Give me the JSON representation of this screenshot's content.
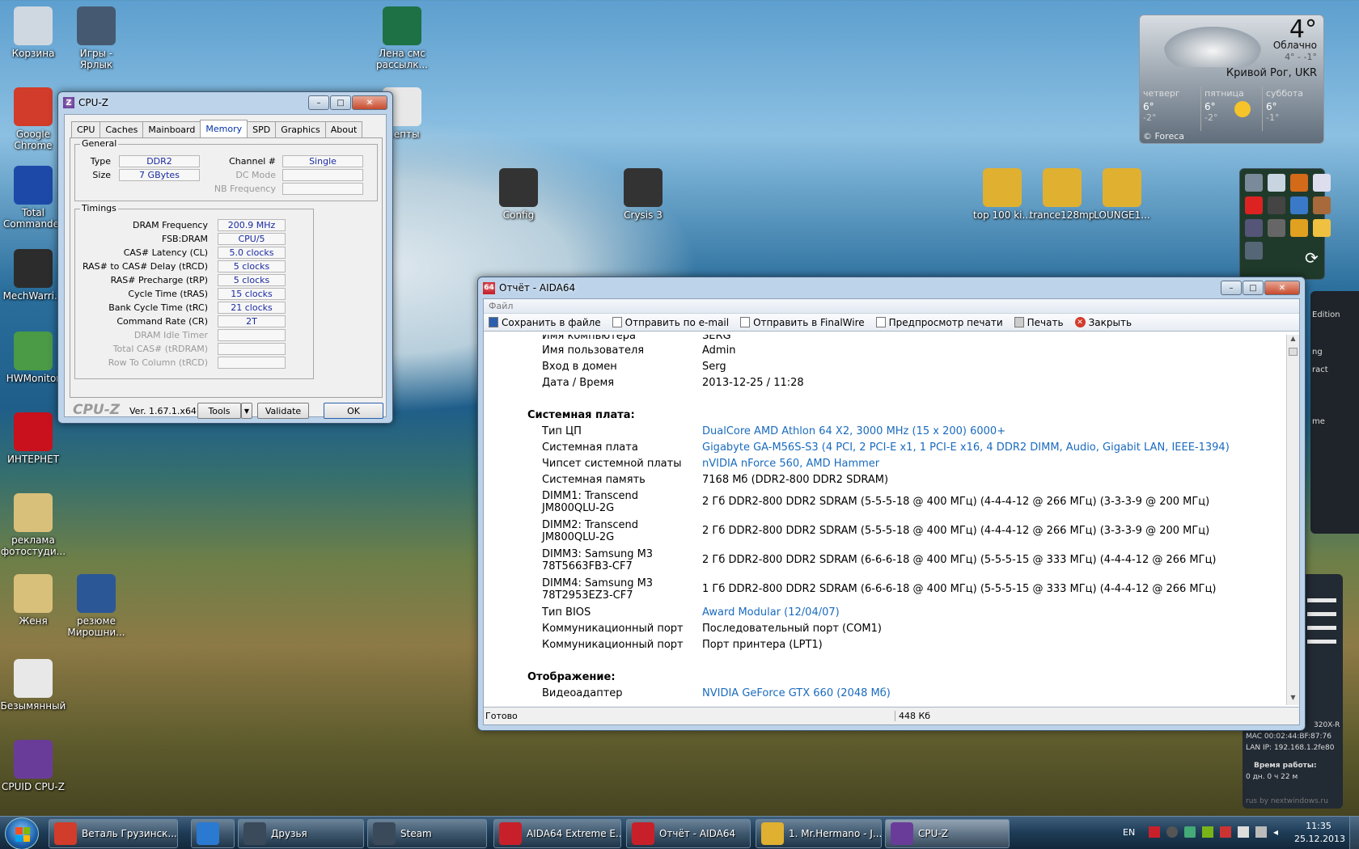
{
  "desktop_icons": [
    {
      "label": "Корзина",
      "icon": "recycle-bin-icon",
      "color": "#cfd8e0"
    },
    {
      "label": "Игры - Ярлык",
      "icon": "games-shortcut-icon",
      "color": "#455a70"
    },
    {
      "label": "Google Chrome",
      "icon": "chrome-icon",
      "color": "#d23c2a"
    },
    {
      "label": "Total Commander",
      "icon": "total-commander-icon",
      "color": "#1d49a8"
    },
    {
      "label": "MechWarri...",
      "icon": "mechwarrior-icon",
      "color": "#2c2c2c"
    },
    {
      "label": "HWMonitor",
      "icon": "hwmonitor-icon",
      "color": "#4a9a46"
    },
    {
      "label": "ИНТЕРНЕТ",
      "icon": "opera-icon",
      "color": "#c8111c"
    },
    {
      "label": "реклама фотостуди...",
      "icon": "folder-icon",
      "color": "#d9c07a"
    },
    {
      "label": "Женя",
      "icon": "folder-icon",
      "color": "#d9c07a"
    },
    {
      "label": "резюме Мирошни...",
      "icon": "word-doc-icon",
      "color": "#2b5797"
    },
    {
      "label": "Безымянный",
      "icon": "image-file-icon",
      "color": "#e8e8e8"
    },
    {
      "label": "CPUID CPU-Z",
      "icon": "cpuz-icon",
      "color": "#6a3c9a"
    },
    {
      "label": "Лена смс рассылк...",
      "icon": "excel-doc-icon",
      "color": "#1e7145"
    },
    {
      "label": "...епты",
      "icon": "document-icon",
      "color": "#e8e8e8"
    },
    {
      "label": "Config",
      "icon": "crysis-config-icon",
      "color": "#333"
    },
    {
      "label": "Crysis 3",
      "icon": "crysis-icon",
      "color": "#333"
    },
    {
      "label": "top 100 ki...",
      "icon": "playlist-icon",
      "color": "#e0b030"
    },
    {
      "label": "trance128mp",
      "icon": "playlist-icon",
      "color": "#e0b030"
    },
    {
      "label": "LOUNGE1...",
      "icon": "playlist-icon",
      "color": "#e0b030"
    }
  ],
  "weather": {
    "temp": "4°",
    "condition": "Облачно",
    "range": "4° - -1°",
    "city": "Кривой Рог, UKR",
    "days": [
      {
        "name": "четверг",
        "hi": "6°",
        "lo": "-2°"
      },
      {
        "name": "пятница",
        "hi": "6°",
        "lo": "-2°"
      },
      {
        "name": "суббота",
        "hi": "6°",
        "lo": "-1°"
      }
    ],
    "source": "© Foreca"
  },
  "cpuz": {
    "title": "CPU-Z",
    "tabs": [
      "CPU",
      "Caches",
      "Mainboard",
      "Memory",
      "SPD",
      "Graphics",
      "About"
    ],
    "active_tab": "Memory",
    "general": {
      "legend": "General",
      "type_label": "Type",
      "type": "DDR2",
      "size_label": "Size",
      "size": "7 GBytes",
      "channel_label": "Channel #",
      "channel": "Single",
      "dc_label": "DC Mode",
      "nb_label": "NB Frequency"
    },
    "timings": {
      "legend": "Timings",
      "rows": [
        {
          "label": "DRAM Frequency",
          "value": "200.9 MHz",
          "dim": false
        },
        {
          "label": "FSB:DRAM",
          "value": "CPU/5",
          "dim": false
        },
        {
          "label": "CAS# Latency (CL)",
          "value": "5.0 clocks",
          "dim": false
        },
        {
          "label": "RAS# to CAS# Delay (tRCD)",
          "value": "5 clocks",
          "dim": false
        },
        {
          "label": "RAS# Precharge (tRP)",
          "value": "5 clocks",
          "dim": false
        },
        {
          "label": "Cycle Time (tRAS)",
          "value": "15 clocks",
          "dim": false
        },
        {
          "label": "Bank Cycle Time (tRC)",
          "value": "21 clocks",
          "dim": false
        },
        {
          "label": "Command Rate (CR)",
          "value": "2T",
          "dim": false
        },
        {
          "label": "DRAM Idle Timer",
          "value": "",
          "dim": true
        },
        {
          "label": "Total CAS# (tRDRAM)",
          "value": "",
          "dim": true
        },
        {
          "label": "Row To Column (tRCD)",
          "value": "",
          "dim": true
        }
      ]
    },
    "footer": {
      "brand": "CPU-Z",
      "version": "Ver. 1.67.1.x64",
      "tools": "Tools",
      "validate": "Validate",
      "ok": "OK"
    }
  },
  "aida": {
    "title": "Отчёт - AIDA64",
    "menu": "Файл",
    "toolbar": [
      "Сохранить в файле",
      "Отправить по e-mail",
      "Отправить в FinalWire",
      "Предпросмотр печати",
      "Печать",
      "Закрыть"
    ],
    "partial_top": {
      "label": "Имя компьютера",
      "value": "SERG"
    },
    "rows": [
      {
        "label": "Имя пользователя",
        "value": "Admin",
        "link": false
      },
      {
        "label": "Вход в домен",
        "value": "Serg",
        "link": false
      },
      {
        "label": "Дата / Время",
        "value": "2013-12-25 / 11:28",
        "link": false
      }
    ],
    "sec_board": "Системная плата:",
    "board_rows": [
      {
        "label": "Тип ЦП",
        "value": "DualCore AMD Athlon 64 X2, 3000 MHz (15 x 200) 6000+",
        "link": true
      },
      {
        "label": "Системная плата",
        "value": "Gigabyte GA-M56S-S3 (4 PCI, 2 PCI-E x1, 1 PCI-E x16, 4 DDR2 DIMM, Audio, Gigabit LAN, IEEE-1394)",
        "link": true
      },
      {
        "label": "Чипсет системной платы",
        "value": "nVIDIA nForce 560, AMD Hammer",
        "link": true
      },
      {
        "label": "Системная память",
        "value": "7168 Мб  (DDR2-800 DDR2 SDRAM)",
        "link": false
      },
      {
        "label": "DIMM1: Transcend JM800QLU-2G",
        "value": "2 Гб DDR2-800 DDR2 SDRAM  (5-5-5-18 @ 400 МГц)  (4-4-4-12 @ 266 МГц)  (3-3-3-9 @ 200 МГц)",
        "link": false
      },
      {
        "label": "DIMM2: Transcend JM800QLU-2G",
        "value": "2 Гб DDR2-800 DDR2 SDRAM  (5-5-5-18 @ 400 МГц)  (4-4-4-12 @ 266 МГц)  (3-3-3-9 @ 200 МГц)",
        "link": false
      },
      {
        "label": "DIMM3: Samsung M3 78T5663FB3-CF7",
        "value": "2 Гб DDR2-800 DDR2 SDRAM  (6-6-6-18 @ 400 МГц)  (5-5-5-15 @ 333 МГц)  (4-4-4-12 @ 266 МГц)",
        "link": false
      },
      {
        "label": "DIMM4: Samsung M3 78T2953EZ3-CF7",
        "value": "1 Гб DDR2-800 DDR2 SDRAM  (6-6-6-18 @ 400 МГц)  (5-5-5-15 @ 333 МГц)  (4-4-4-12 @ 266 МГц)",
        "link": false
      },
      {
        "label": "Тип BIOS",
        "value": "Award Modular (12/04/07)",
        "link": true
      },
      {
        "label": "Коммуникационный порт",
        "value": "Последовательный порт (COM1)",
        "link": false
      },
      {
        "label": "Коммуникационный порт",
        "value": "Порт принтера (LPT1)",
        "link": false
      }
    ],
    "sec_display": "Отображение:",
    "display_rows": [
      {
        "label": "Видеоадаптер",
        "value": "NVIDIA GeForce GTX 660  (2048 Мб)",
        "link": true
      }
    ],
    "status_left": "Готово",
    "status_right": "448 Кб"
  },
  "side_gadget": {
    "mac": "MAC   00:02:44:BF:87:76",
    "lan": "LAN IP:   192.168.1.2fe80",
    "uptime_label": "Время работы:",
    "uptime": "0 дн. 0 ч 22 м",
    "credit": "rus by nextwindows.ru",
    "frag1": "Edition",
    "frag2": "ng",
    "frag3": "ract",
    "frag4": "me",
    "frag5": "320X-R"
  },
  "taskbar": {
    "buttons": [
      {
        "label": "Веталь Грузинск...",
        "icon": "chrome-icon",
        "color": "#d23c2a"
      },
      {
        "label": "",
        "icon": "ie-icon",
        "color": "#2a7ad2"
      },
      {
        "label": "Друзья",
        "icon": "steam-icon",
        "color": "#3a4a5a"
      },
      {
        "label": "Steam",
        "icon": "steam-icon",
        "color": "#3a4a5a"
      },
      {
        "label": "AIDA64 Extreme E...",
        "icon": "aida64-icon",
        "color": "#c8202a"
      },
      {
        "label": "Отчёт - AIDA64",
        "icon": "aida64-icon",
        "color": "#c8202a"
      },
      {
        "label": "1. Mr.Hermano - J...",
        "icon": "winamp-icon",
        "color": "#e0b030"
      },
      {
        "label": "CPU-Z",
        "icon": "cpuz-icon",
        "color": "#6a3c9a"
      }
    ],
    "lang": "EN",
    "time": "11:35",
    "date": "25.12.2013"
  }
}
